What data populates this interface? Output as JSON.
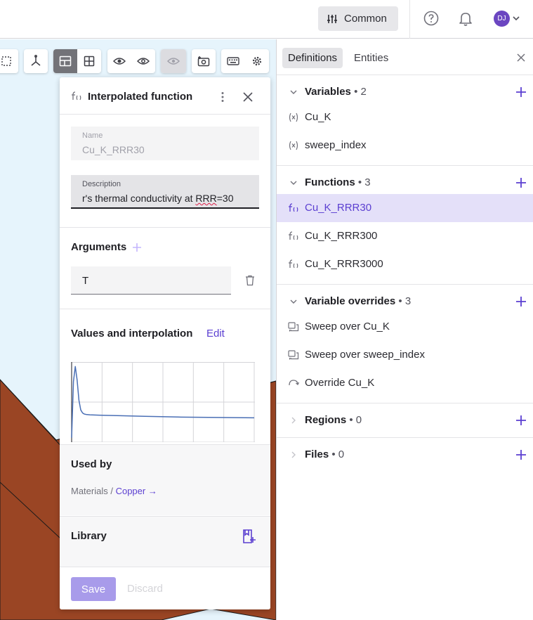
{
  "topbar": {
    "common_label": "Common",
    "avatar_initials": "DJ"
  },
  "viewport": {
    "background_color": "#e6f4fc",
    "shape_color": "#9a4524"
  },
  "panel": {
    "title": "Interpolated function",
    "name_label": "Name",
    "name_value": "Cu_K_RRR30",
    "description_label": "Description",
    "description_prefix": "r's thermal conductivity at ",
    "description_underlined": "RRR",
    "description_suffix": "=30",
    "arguments_title": "Arguments",
    "argument_value": "T",
    "values_title": "Values and interpolation",
    "edit_label": "Edit",
    "used_by_title": "Used by",
    "used_by_path": "Materials / ",
    "used_by_link": "Copper →",
    "library_title": "Library",
    "save_label": "Save",
    "discard_label": "Discard"
  },
  "chart_data": {
    "type": "line",
    "title": "",
    "xlabel": "",
    "ylabel": "",
    "grid": true,
    "series": [
      {
        "x": [
          0,
          1,
          2,
          3,
          4,
          5,
          6,
          7,
          8,
          10,
          15,
          25,
          40,
          60,
          80,
          100
        ],
        "values": [
          0.05,
          0.8,
          1.0,
          0.82,
          0.55,
          0.42,
          0.38,
          0.365,
          0.36,
          0.355,
          0.35,
          0.345,
          0.335,
          0.325,
          0.32,
          0.315
        ]
      }
    ],
    "xlim": [
      0,
      100
    ],
    "ylim": [
      0,
      1.05
    ]
  },
  "right_panel": {
    "tabs": [
      "Definitions",
      "Entities"
    ],
    "groups": [
      {
        "name": "Variables",
        "count": "• 2",
        "items": [
          {
            "icon": "variable-icon",
            "label": "Cu_K"
          },
          {
            "icon": "variable-icon",
            "label": "sweep_index"
          }
        ]
      },
      {
        "name": "Functions",
        "count": "• 3",
        "items": [
          {
            "icon": "function-icon",
            "label": "Cu_K_RRR30"
          },
          {
            "icon": "function-icon",
            "label": "Cu_K_RRR300"
          },
          {
            "icon": "function-icon",
            "label": "Cu_K_RRR3000"
          }
        ]
      },
      {
        "name": "Variable overrides",
        "count": "• 3",
        "items": [
          {
            "icon": "sweep-icon",
            "label": "Sweep over Cu_K"
          },
          {
            "icon": "sweep-icon",
            "label": "Sweep over sweep_index"
          },
          {
            "icon": "override-icon",
            "label": "Override Cu_K"
          }
        ]
      },
      {
        "name": "Regions",
        "count": "• 0",
        "items": []
      },
      {
        "name": "Files",
        "count": "•  0",
        "items": []
      }
    ],
    "accent_color": "#5b3fd1",
    "selected_bg": "#e4e0f9"
  }
}
